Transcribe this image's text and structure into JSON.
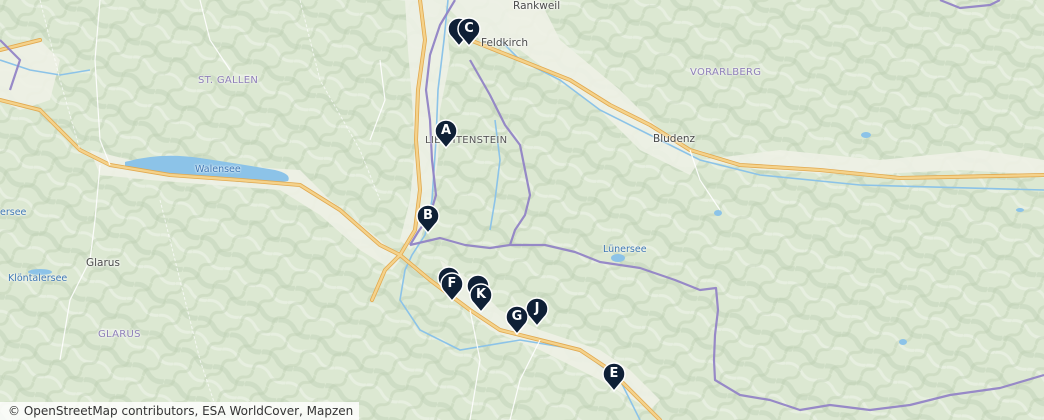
{
  "map": {
    "colors": {
      "land": "#dce8d2",
      "relief_dark": "#c4d3bb",
      "relief_light": "#eef3ea",
      "forest": "#c9dcbd",
      "valley": "#eef1e6",
      "lake": "#8cc3e8",
      "road": "#f4c87a",
      "road_casing": "#e2a94f",
      "border": "#9284c6",
      "marker": "#0f2036"
    },
    "places": [
      {
        "id": "rankweil",
        "name": "Rankweil"
      },
      {
        "id": "feldkirch",
        "name": "Feldkirch"
      },
      {
        "id": "st-gallen",
        "name": "ST. GALLEN"
      },
      {
        "id": "vorarlberg",
        "name": "VORARLBERG"
      },
      {
        "id": "liechtenstein",
        "name": "LIECHTENSTEIN"
      },
      {
        "id": "bludenz",
        "name": "Bludenz"
      },
      {
        "id": "walensee",
        "name": "Walensee"
      },
      {
        "id": "lunersee",
        "name": "Lünersee"
      },
      {
        "id": "glarus",
        "name": "Glarus"
      },
      {
        "id": "klontalersee",
        "name": "Klöntalersee"
      },
      {
        "id": "glarus-region",
        "name": "GLARUS"
      },
      {
        "id": "ersee",
        "name": "ersee"
      }
    ],
    "markers": [
      {
        "label": "A"
      },
      {
        "label": "B"
      },
      {
        "label": "C"
      },
      {
        "label": "E"
      },
      {
        "label": "F"
      },
      {
        "label": "G"
      },
      {
        "label": "J"
      },
      {
        "label": "K"
      }
    ],
    "attribution": "© OpenStreetMap contributors, ESA WorldCover, Mapzen"
  }
}
